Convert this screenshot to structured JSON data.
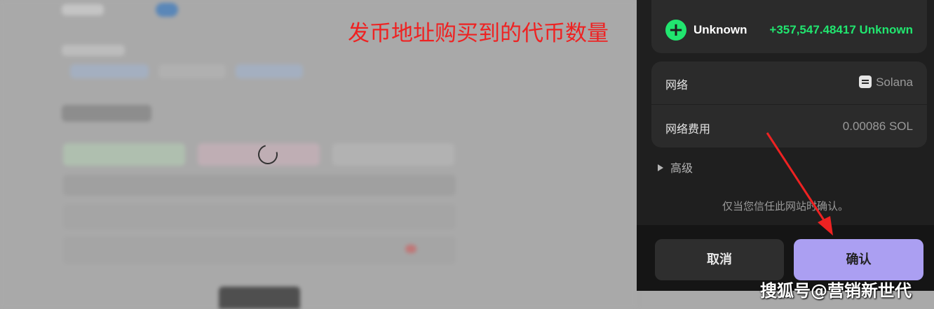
{
  "annotation": "发币地址购买到的代币数量",
  "token": {
    "name": "Unknown",
    "amount": "+357,547.48417 Unknown"
  },
  "network": {
    "label": "网络",
    "value": "Solana",
    "fee_label": "网络费用",
    "fee_value": "0.00086 SOL"
  },
  "advanced_label": "高级",
  "trust_notice": "仅当您信任此网站时确认。",
  "buttons": {
    "cancel": "取消",
    "confirm": "确认"
  },
  "watermark": "搜狐号@营销新世代",
  "colors": {
    "accent_green": "#21e56f",
    "confirm_purple": "#ab9ff2",
    "annotation_red": "#ee2222"
  }
}
